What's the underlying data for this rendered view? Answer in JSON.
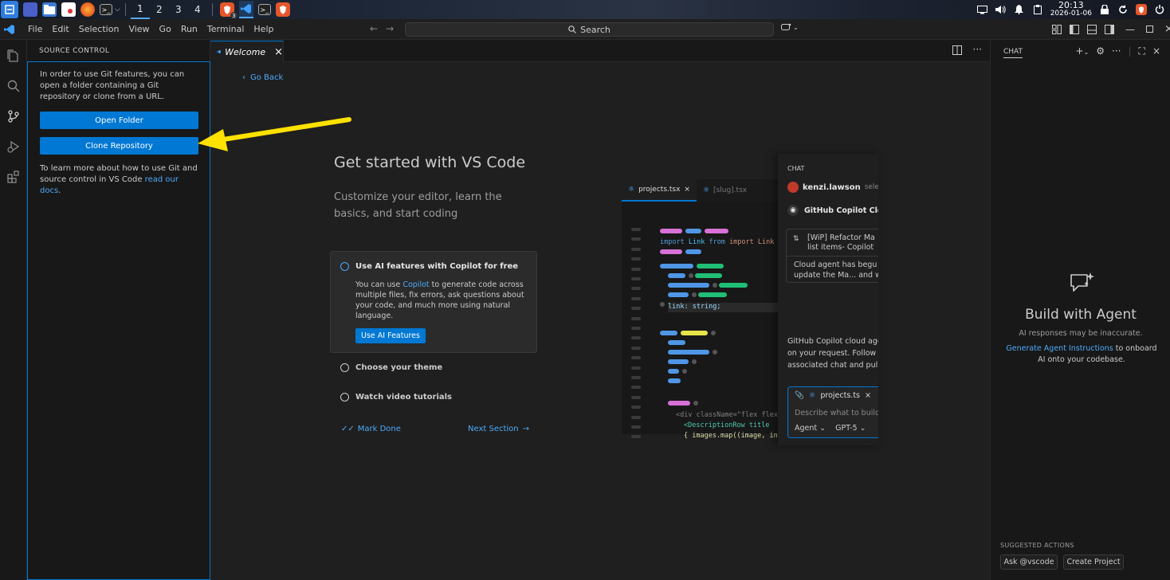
{
  "taskbar": {
    "workspaces": [
      "1",
      "2",
      "3",
      "4"
    ],
    "active_workspace": 0,
    "clock_time": "20:13",
    "clock_date": "2026-01-06",
    "apps": [
      "launcher-icon",
      "desktop-icon",
      "file-manager-icon",
      "document-viewer-icon",
      "firefox-icon",
      "terminal-icon",
      "brave-icon",
      "vscode-icon",
      "terminal-icon",
      "brave-icon"
    ],
    "brave_badge": "3"
  },
  "titlebar": {
    "menus": [
      "File",
      "Edit",
      "Selection",
      "View",
      "Go",
      "Run",
      "Terminal",
      "Help"
    ],
    "search_label": "Search"
  },
  "sidebar": {
    "header": "SOURCE CONTROL",
    "intro": "In order to use Git features, you can open a folder containing a Git repository or clone from a URL.",
    "open_folder": "Open Folder",
    "clone_repository": "Clone Repository",
    "learn_more": "To learn more about how to use Git and source control in VS Code ",
    "docs_link": "read our docs",
    "learn_more_end": "."
  },
  "editor": {
    "tab_label": "Welcome",
    "go_back": "Go Back",
    "title": "Get started with VS Code",
    "subtitle": "Customize your editor, learn the basics, and start coding",
    "steps": {
      "active": {
        "title": "Use AI features with Copilot for free",
        "desc_before": "You can use ",
        "desc_link": "Copilot",
        "desc_after": " to generate code across multiple files, fix errors, ask questions about your code, and much more using natural language.",
        "button": "Use AI Features"
      },
      "theme": "Choose your theme",
      "videos": "Watch video tutorials"
    },
    "mark_done": "Mark Done",
    "next_section": "Next Section",
    "mockup": {
      "tab1": "projects.tsx",
      "tab2": "[slug].tsx",
      "code_import": "import Link from \"next/link",
      "code_link": "link: string;",
      "code_div": "<div className=\"flex flex",
      "code_row": "<DescriptionRow title",
      "code_map": "{ images.map((image, in",
      "chat_header": "CHAT",
      "chat_user": "kenzi.lawson",
      "chat_user_suffix": "selec",
      "chat_agent": "GitHub Copilot Clo",
      "chat_pr_title_1": "[WiP] Refactor Ma",
      "chat_pr_title_2": "list items- Copilot",
      "chat_pr_body_1": "Cloud agent has begu",
      "chat_pr_body_2": "update the Ma... and w",
      "chat_text_1": "GitHub Copilot cloud age",
      "chat_text_2": "on your request. Follow i",
      "chat_text_3": "associated chat and pull",
      "chat_file_chip": "projects.ts",
      "chat_placeholder": "Describe what to build",
      "chat_mode": "Agent",
      "chat_model": "GPT-5"
    }
  },
  "chat": {
    "title": "CHAT",
    "heading": "Build with Agent",
    "note": "AI responses may be inaccurate.",
    "instructions_link": "Generate Agent Instructions",
    "instructions_rest": " to onboard AI onto your codebase.",
    "suggested_label": "SUGGESTED ACTIONS",
    "suggested": [
      "Ask @vscode",
      "Create Project"
    ]
  },
  "colors": {
    "accent": "#0078d4",
    "link": "#4daafc",
    "annotation_arrow": "#ffe100"
  }
}
